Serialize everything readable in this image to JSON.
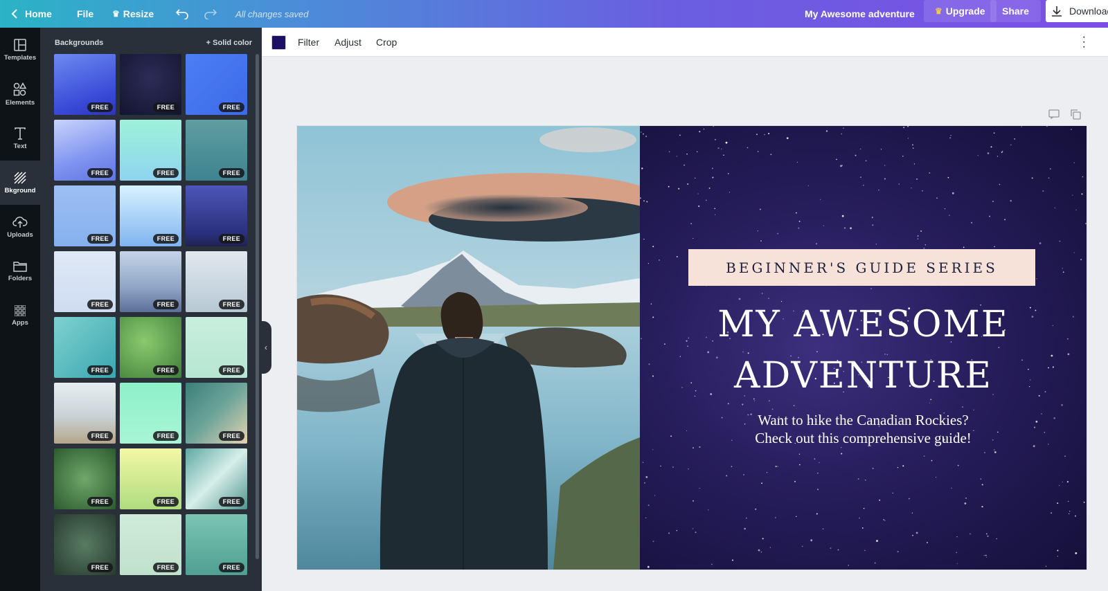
{
  "topbar": {
    "home": "Home",
    "file": "File",
    "resize": "Resize",
    "saved_status": "All changes saved",
    "design_title": "My Awesome adventure",
    "upgrade": "Upgrade",
    "share": "Share",
    "download": "Download"
  },
  "rail": {
    "items": [
      {
        "label": "Templates",
        "icon": "templates-icon"
      },
      {
        "label": "Elements",
        "icon": "elements-icon"
      },
      {
        "label": "Text",
        "icon": "text-icon"
      },
      {
        "label": "Bkground",
        "icon": "background-icon"
      },
      {
        "label": "Uploads",
        "icon": "upload-cloud-icon"
      },
      {
        "label": "Folders",
        "icon": "folder-icon"
      },
      {
        "label": "Apps",
        "icon": "apps-grid-icon"
      }
    ]
  },
  "panel": {
    "heading": "Backgrounds",
    "solid_color": "+ Solid color",
    "badge": "FREE",
    "tiles": [
      {
        "name": "blue-gradient",
        "fill": "linear-gradient(160deg,#6c8bf0 0%,#3a4ad8 70%,#2d35b8 100%)"
      },
      {
        "name": "night-sky",
        "fill": "radial-gradient(circle at 50% 40%,#2c2c58 0%,#14142e 100%)"
      },
      {
        "name": "blue-hexagons",
        "fill": "linear-gradient(135deg,#4d7ef5,#3d6ae8)"
      },
      {
        "name": "blue-dandelion",
        "fill": "linear-gradient(160deg,#c9d3fb 0%,#7f93f0 60%,#5f73e4 100%)"
      },
      {
        "name": "mint-gradient",
        "fill": "linear-gradient(180deg,#9ef2d9 0%,#8fd4f0 100%)"
      },
      {
        "name": "water-ripples",
        "fill": "linear-gradient(180deg,#5f9ea0 0%,#3e8390 100%)"
      },
      {
        "name": "blue-chevron",
        "fill": "linear-gradient(180deg,#9cc0f3,#86b0ee)"
      },
      {
        "name": "sky-gradient",
        "fill": "linear-gradient(180deg,#d8f2ff 0%,#7fb4f0 100%)"
      },
      {
        "name": "lightning-sky",
        "fill": "linear-gradient(180deg,#4d56b8 0%,#2a2f7a 80%,#1e2250 100%)"
      },
      {
        "name": "pale-pattern",
        "fill": "linear-gradient(180deg,#dfe8f6,#cfdcf0)"
      },
      {
        "name": "misty-mountains",
        "fill": "linear-gradient(180deg,#c5d4e6 0%,#8fa5c6 60%,#5d6f98 100%)"
      },
      {
        "name": "foggy-hills",
        "fill": "linear-gradient(180deg,#e2e9ee 0%,#b7c8d4 100%)"
      },
      {
        "name": "pool-water",
        "fill": "linear-gradient(135deg,#7fd1cf 0%,#3aa6b0 100%)"
      },
      {
        "name": "green-leaves",
        "fill": "radial-gradient(circle at 40% 40%,#8bc96e 0%,#3f7f3a 100%)"
      },
      {
        "name": "mint-dots",
        "fill": "linear-gradient(180deg,#c9eedd,#b6e6d2)"
      },
      {
        "name": "beach-shore",
        "fill": "linear-gradient(180deg,#e6eef2 0%,#c9d3d6 55%,#b5a58a 100%)"
      },
      {
        "name": "green-gradient",
        "fill": "linear-gradient(180deg,#8ef0c9 0%,#a8f5d6 100%)"
      },
      {
        "name": "aerial-beach",
        "fill": "linear-gradient(135deg,#3b7f7a 0%,#6fa59a 50%,#e4d3b0 100%)"
      },
      {
        "name": "tropical-leaves",
        "fill": "radial-gradient(circle at 50% 50%,#6fa86a 0%,#2d5a30 100%)"
      },
      {
        "name": "lime-gradient",
        "fill": "linear-gradient(180deg,#f3f7a6 0%,#aedc7e 100%)"
      },
      {
        "name": "ocean-foam",
        "fill": "linear-gradient(135deg,#5fa9a3 0%,#d7eee8 50%,#4f958f 100%)"
      },
      {
        "name": "fern-leaves",
        "fill": "radial-gradient(circle at 50% 50%,#587c62 0%,#283a30 100%)"
      },
      {
        "name": "mint-diamond",
        "fill": "linear-gradient(180deg,#d0ead9,#bfe2cc)"
      },
      {
        "name": "sea-surface",
        "fill": "linear-gradient(180deg,#7cc4b2 0%,#4f9f92 100%)"
      }
    ]
  },
  "toolbar": {
    "swatch_color": "#1b1063",
    "filter": "Filter",
    "adjust": "Adjust",
    "crop": "Crop"
  },
  "design": {
    "series_label": "BEGINNER'S GUIDE SERIES",
    "headline_line1": "MY AWESOME",
    "headline_line2": "ADVENTURE",
    "sub_line1": "Want to hike the Canadian Rockies?",
    "sub_line2": "Check out this comprehensive guide!"
  }
}
